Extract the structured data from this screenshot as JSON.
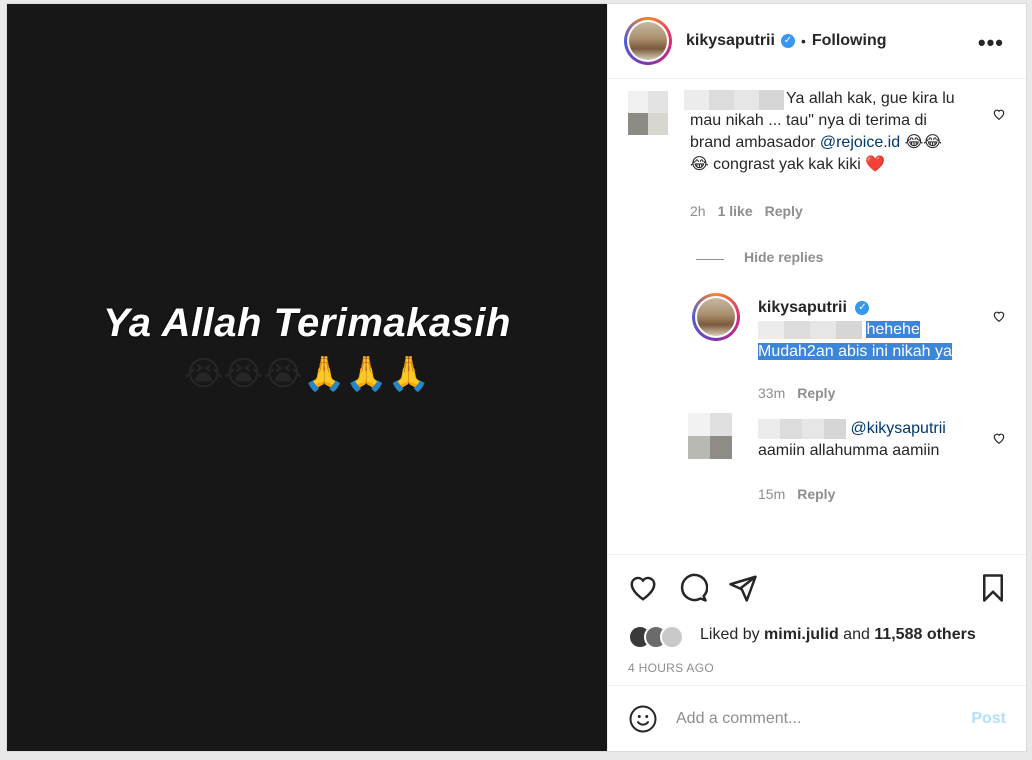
{
  "media": {
    "title": "Ya Allah Terimakasih",
    "emojis": "😭😭😭🙏🙏🙏"
  },
  "header": {
    "username": "kikysaputrii",
    "separator": "•",
    "follow_status": "Following",
    "more_label": "•••"
  },
  "comments": [
    {
      "text_part1": "Ya allah kak, gue kira lu",
      "text_part2": "mau nikah ... tau\" nya di terima di",
      "text_part3": "brand ambasador ",
      "mention": "@rejoice.id",
      "emojis_inline": " 😂😂",
      "text_part4": "😂 congrast yak kak kiki ❤️",
      "time": "2h",
      "likes": "1 like",
      "reply_label": "Reply"
    }
  ],
  "hide_replies": "Hide replies",
  "replies": [
    {
      "username": "kikysaputrii",
      "text_line1": "hehehe",
      "text_line2": "Mudah2an abis ini nikah ya",
      "time": "33m",
      "reply_label": "Reply"
    },
    {
      "mention": "@kikysaputrii",
      "text": "aamiin allahumma aamiin",
      "time": "15m",
      "reply_label": "Reply"
    }
  ],
  "likes": {
    "prefix": "Liked by ",
    "user": "mimi.julid",
    "middle": " and ",
    "others": "11,588 others"
  },
  "timestamp": "4 HOURS AGO",
  "comment_input": {
    "placeholder": "Add a comment...",
    "post_label": "Post"
  },
  "colors": {
    "link": "#00376b",
    "verified": "#3897f0",
    "selection": "#3b86d8"
  }
}
